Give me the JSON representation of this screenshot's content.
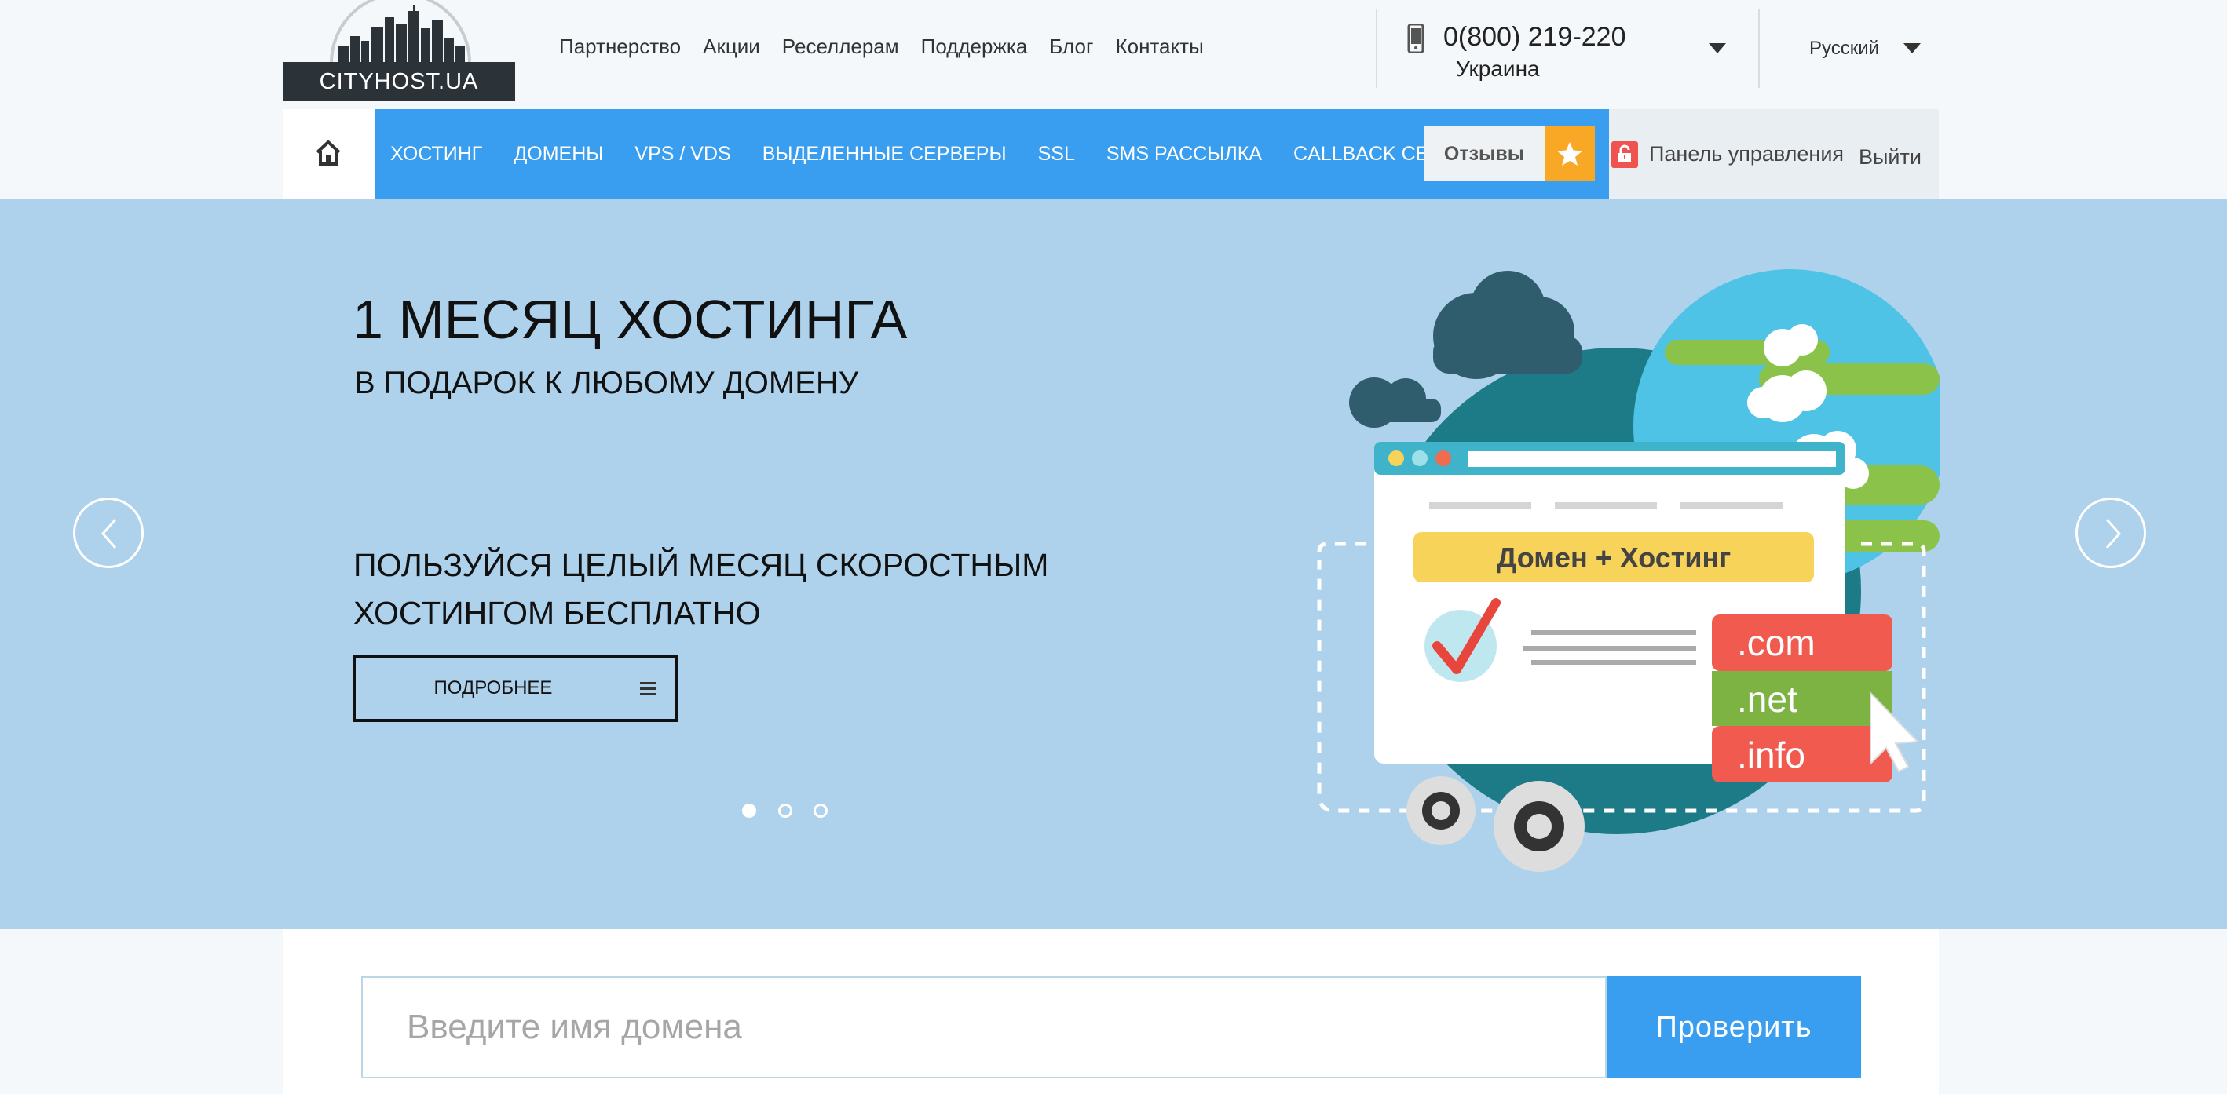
{
  "logo": {
    "text": "CITYHOST.UA"
  },
  "top_nav": [
    "Партнерство",
    "Акции",
    "Реселлерам",
    "Поддержка",
    "Блог",
    "Контакты"
  ],
  "contact": {
    "phone": "0(800) 219-220",
    "country": "Украина"
  },
  "language": {
    "selected": "Русский"
  },
  "main_nav": [
    "ХОСТИНГ",
    "ДОМЕНЫ",
    "VPS / VDS",
    "ВЫДЕЛЕННЫЕ СЕРВЕРЫ",
    "SSL",
    "SMS РАССЫЛКА",
    "CALLBACK СЕРВИС"
  ],
  "reviews_label": "Отзывы",
  "account": {
    "panel_label": "Панель управления",
    "logout_label": "Выйти"
  },
  "hero": {
    "title": "1 МЕСЯЦ ХОСТИНГА",
    "subtitle": "В ПОДАРОК К ЛЮБОМУ ДОМЕНУ",
    "description_line1": "ПОЛЬЗУЙСЯ ЦЕЛЫЙ МЕСЯЦ СКОРОСТНЫМ",
    "description_line2": "ХОСТИНГОМ БЕСПЛАТНО",
    "more_button": "ПОДРОБНЕЕ",
    "slides_total": 3,
    "active_slide": 1,
    "illustration": {
      "banner": "Домен + Хостинг",
      "tlds": [
        ".com",
        ".net",
        ".info"
      ]
    }
  },
  "search": {
    "placeholder": "Введите имя домена",
    "value": "",
    "button": "Проверить"
  },
  "colors": {
    "brand_blue": "#3a9ef0",
    "hero_bg": "#aed1ec",
    "accent_orange": "#f9a825",
    "logo_dark": "#2b3238",
    "lock_red": "#ef5350"
  }
}
